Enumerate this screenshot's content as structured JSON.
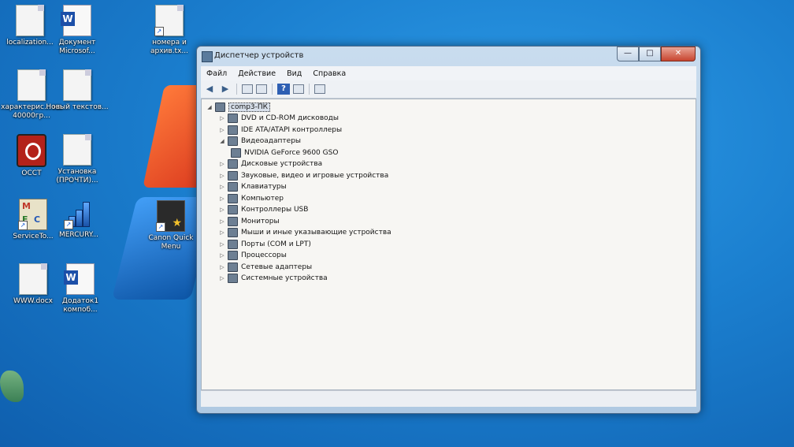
{
  "desktop": {
    "icons": [
      {
        "label": "localization...",
        "icon": "document-icon"
      },
      {
        "label": "Документ Microsof...",
        "icon": "word-document-icon"
      },
      {
        "label": "номера и архив.tx...",
        "icon": "text-file-icon"
      },
      {
        "label": "характерис... на 40000гр...",
        "icon": "document-icon"
      },
      {
        "label": "Новый текстов...",
        "icon": "text-file-icon"
      },
      {
        "label": "OCCT",
        "icon": "occt-icon"
      },
      {
        "label": "Установка (ПРОЧТИ)...",
        "icon": "text-file-icon"
      },
      {
        "label": "ServiceTo...",
        "icon": "mfc-icon"
      },
      {
        "label": "MERCURY...",
        "icon": "mercury-icon"
      },
      {
        "label": "Canon Quick Menu",
        "icon": "canon-icon"
      },
      {
        "label": "WWW.docx",
        "icon": "document-icon"
      },
      {
        "label": "Додаток1 компоб...",
        "icon": "word-document-icon"
      }
    ]
  },
  "window": {
    "title": "Диспетчер устройств",
    "controls": {
      "minimize": "—",
      "maximize": "□",
      "close": "✕"
    },
    "menu": [
      "Файл",
      "Действие",
      "Вид",
      "Справка"
    ],
    "toolbar": {
      "back": "◀",
      "forward": "▶",
      "help": "?"
    },
    "tree": {
      "root": "comp3-ПК",
      "nodes": [
        {
          "label": "DVD и CD-ROM дисководы",
          "expanded": false
        },
        {
          "label": "IDE ATA/ATAPI контроллеры",
          "expanded": false
        },
        {
          "label": "Видеоадаптеры",
          "expanded": true,
          "children": [
            "NVIDIA GeForce 9600 GSO"
          ]
        },
        {
          "label": "Дисковые устройства",
          "expanded": false
        },
        {
          "label": "Звуковые, видео и игровые устройства",
          "expanded": false
        },
        {
          "label": "Клавиатуры",
          "expanded": false
        },
        {
          "label": "Компьютер",
          "expanded": false
        },
        {
          "label": "Контроллеры USB",
          "expanded": false
        },
        {
          "label": "Мониторы",
          "expanded": false
        },
        {
          "label": "Мыши и иные указывающие устройства",
          "expanded": false
        },
        {
          "label": "Порты (COM и LPT)",
          "expanded": false
        },
        {
          "label": "Процессоры",
          "expanded": false
        },
        {
          "label": "Сетевые адаптеры",
          "expanded": false
        },
        {
          "label": "Системные устройства",
          "expanded": false
        }
      ]
    }
  }
}
